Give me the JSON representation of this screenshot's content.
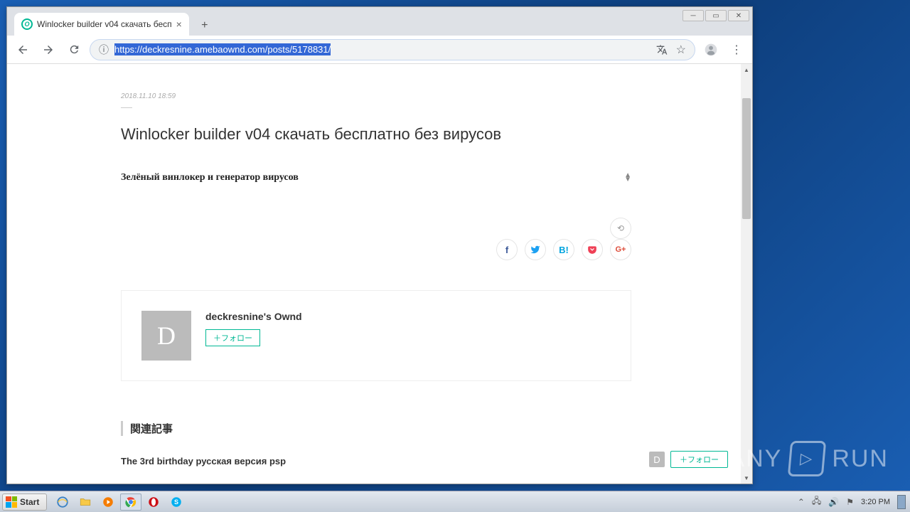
{
  "browser": {
    "tab_title": "Winlocker builder v04 скачать бесп",
    "url": "https://deckresnine.amebaownd.com/posts/5178831/"
  },
  "page": {
    "date": "2018.11.10 18:59",
    "title": "Winlocker builder v04 скачать бесплатно без вирусов",
    "subtitle": "Зелёный винлокер и генератор вирусов",
    "author_name": "deckresnine's Ownd",
    "author_initial": "D",
    "follow_label": "＋フォロー",
    "related_heading": "関連記事",
    "related_link": "The 3rd birthday русская версия psp"
  },
  "float": {
    "initial": "D",
    "follow_label": "＋フォロー"
  },
  "taskbar": {
    "start": "Start",
    "time": "3:20 PM"
  },
  "watermark": {
    "text": "ANY",
    "text2": "RUN"
  }
}
